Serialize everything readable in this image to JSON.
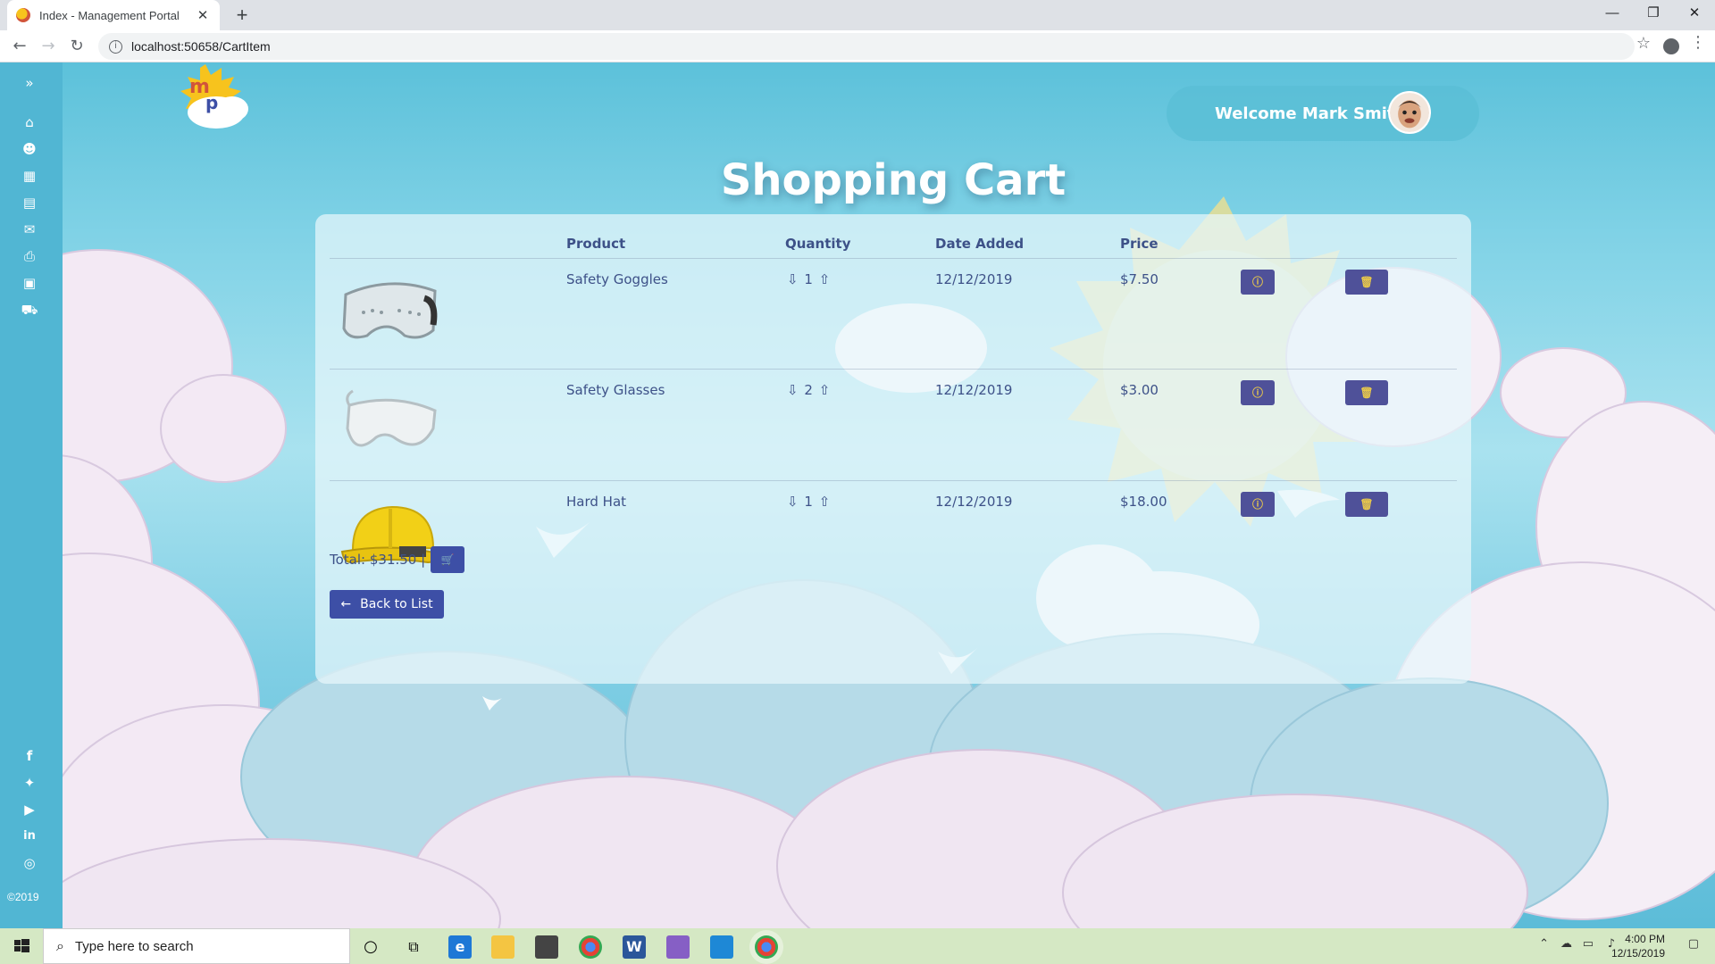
{
  "browser": {
    "tab_title": "Index - Management Portal",
    "tab_close": "✕",
    "new_tab": "+",
    "url": "localhost:50658/CartItem",
    "minimize": "—",
    "restore": "❐",
    "close": "✕"
  },
  "app": {
    "logo_letters": "mp",
    "welcome": "Welcome Mark Smith",
    "page_title": "Shopping Cart",
    "copyright": "©2019"
  },
  "sidebar": {
    "top_icons": [
      "expand-icon",
      "home-icon",
      "users-icon",
      "calendar-icon",
      "id-card-icon",
      "chat-icon",
      "print-icon",
      "briefcase-icon",
      "cart-icon"
    ],
    "social_icons": [
      "facebook-icon",
      "twitter-icon",
      "youtube-icon",
      "linkedin-icon",
      "instagram-icon"
    ]
  },
  "cart": {
    "headers": {
      "product": "Product",
      "quantity": "Quantity",
      "date": "Date Added",
      "price": "Price"
    },
    "items": [
      {
        "product": "Safety Goggles",
        "qty_down": "⇩",
        "quantity": "1",
        "qty_up": "⇧",
        "date": "12/12/2019",
        "price": "$7.50"
      },
      {
        "product": "Safety Glasses",
        "qty_down": "⇩",
        "quantity": "2",
        "qty_up": "⇧",
        "date": "12/12/2019",
        "price": "$3.00"
      },
      {
        "product": "Hard Hat",
        "qty_down": "⇩",
        "quantity": "1",
        "qty_up": "⇧",
        "date": "12/12/2019",
        "price": "$18.00"
      }
    ],
    "total": "Total: $31.50 |",
    "back_label": "Back to List"
  },
  "taskbar": {
    "search_placeholder": "Type here to search",
    "time": "4:00 PM",
    "date": "12/15/2019"
  },
  "colors": {
    "accent": "#4f5199",
    "text": "#3d5188",
    "sidebar": "#51b6d3"
  }
}
